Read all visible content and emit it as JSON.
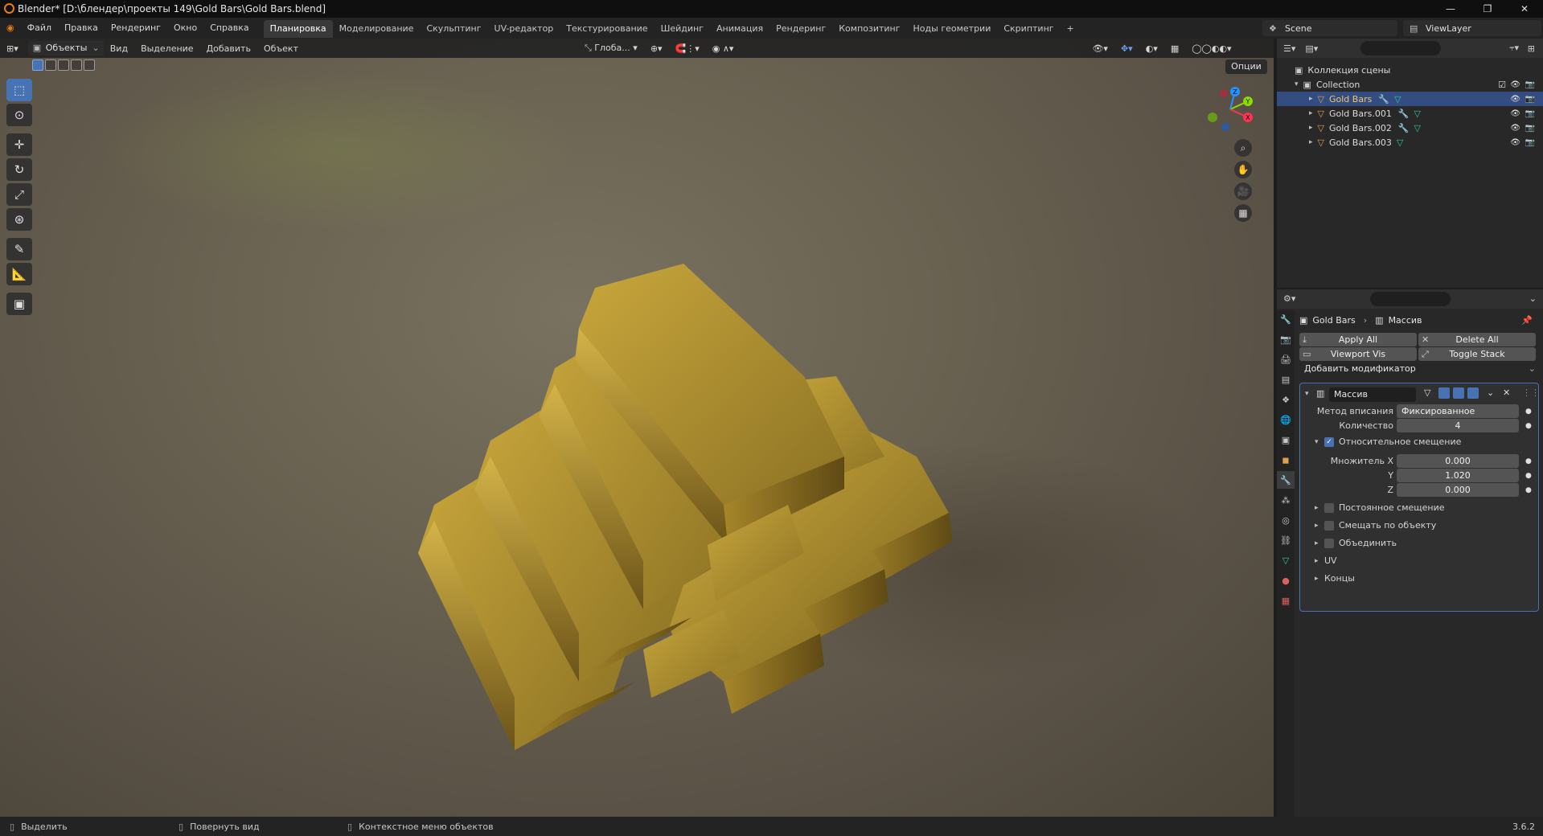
{
  "window": {
    "title": "Blender* [D:\\блендер\\проекты 149\\Gold Bars\\Gold Bars.blend]",
    "controls": [
      "—",
      "❐",
      "✕"
    ]
  },
  "menu": {
    "items": [
      "Файл",
      "Правка",
      "Рендеринг",
      "Окно",
      "Справка"
    ],
    "workspaces": [
      "Планировка",
      "Моделирование",
      "Скульптинг",
      "UV-редактор",
      "Текстурирование",
      "Шейдинг",
      "Анимация",
      "Рендеринг",
      "Композитинг",
      "Ноды геометрии",
      "Скриптинг"
    ],
    "active_workspace": "Планировка",
    "add_tab": "+",
    "scene": "Scene",
    "view_layer": "ViewLayer"
  },
  "viewport": {
    "mode": "Объекты",
    "menus": [
      "Вид",
      "Выделение",
      "Добавить",
      "Объект"
    ],
    "transform_orientation": "Глоба...",
    "options": "Опции",
    "gizmo_axes": [
      "X",
      "Y",
      "Z"
    ]
  },
  "outliner": {
    "scene_collection": "Коллекция сцены",
    "collection": "Collection",
    "objects": [
      {
        "name": "Gold Bars",
        "selected": true,
        "has_modifier": true
      },
      {
        "name": "Gold Bars.001",
        "selected": false,
        "has_modifier": true
      },
      {
        "name": "Gold Bars.002",
        "selected": false,
        "has_modifier": true
      },
      {
        "name": "Gold Bars.003",
        "selected": false,
        "has_modifier": false
      }
    ]
  },
  "properties": {
    "breadcrumb_object": "Gold Bars",
    "breadcrumb_modifier": "Массив",
    "apply_all": "Apply All",
    "delete_all": "Delete All",
    "viewport_vis": "Viewport Vis",
    "toggle_stack": "Toggle Stack",
    "add_modifier": "Добавить модификатор",
    "modifier": {
      "name": "Массив",
      "fit_type_label": "Метод вписания",
      "fit_type_value": "Фиксированное количество",
      "count_label": "Количество",
      "count_value": "4",
      "relative_offset_label": "Относительное смещение",
      "relative_offset_enabled": true,
      "factor_x_label": "Множитель X",
      "factor_x": "0.000",
      "factor_y_label": "Y",
      "factor_y": "1.020",
      "factor_z_label": "Z",
      "factor_z": "0.000",
      "constant_offset": "Постоянное смещение",
      "object_offset": "Смещать по объекту",
      "merge": "Объединить",
      "uv": "UV",
      "caps": "Концы"
    }
  },
  "status": {
    "select": "Выделить",
    "rotate_view": "Повернуть вид",
    "context_menu": "Контекстное меню объектов",
    "version": "3.6.2"
  },
  "colors": {
    "accent": "#4772b3",
    "gold_light": "#d8b850",
    "gold_mid": "#a88a2c",
    "gold_dark": "#6b5318"
  }
}
